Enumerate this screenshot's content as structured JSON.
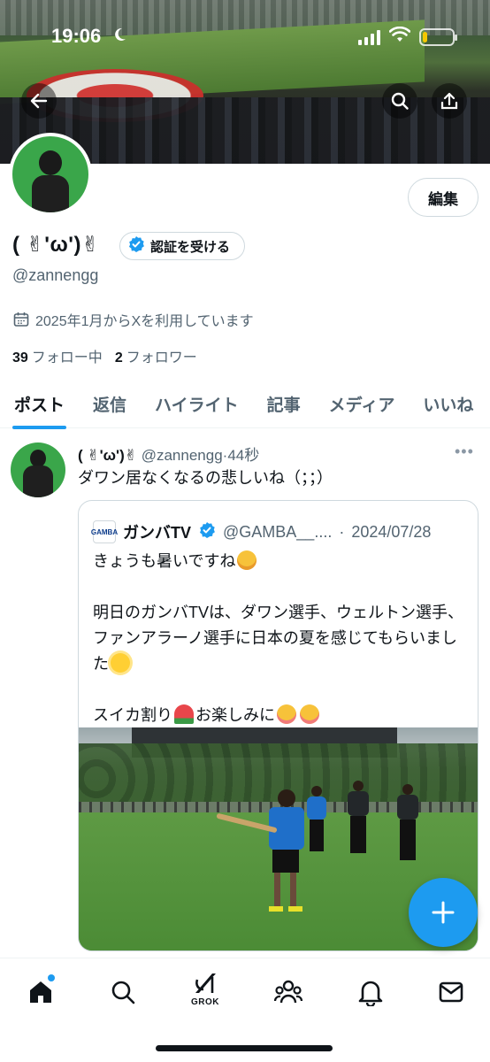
{
  "status_bar": {
    "time": "19:06",
    "battery_level": 0.15
  },
  "profile": {
    "edit_label": "編集",
    "display_name": "( ✌︎'ω')✌︎",
    "verify_label": "認証を受ける",
    "handle": "@zannengg",
    "joined": "2025年1月からXを利用しています",
    "following_count": "39",
    "following_label": "フォロー中",
    "followers_count": "2",
    "followers_label": "フォロワー"
  },
  "tabs": [
    {
      "label": "ポスト",
      "active": true
    },
    {
      "label": "返信"
    },
    {
      "label": "ハイライト"
    },
    {
      "label": "記事"
    },
    {
      "label": "メディア"
    },
    {
      "label": "いいね"
    }
  ],
  "post": {
    "name": "( ✌︎'ω')✌︎",
    "handle": "@zannengg",
    "time": "44秒",
    "text": "ダワン居なくなるの悲しいね（；；）",
    "quote": {
      "logo_text": "GAMBA",
      "name": "ガンバTV",
      "handle": "@GAMBA__....",
      "date": "2024/07/28",
      "line1": "きょうも暑いですね",
      "line2": "明日のガンバTVは、ダワン選手、ウェルトン選手、ファンアラーノ選手に日本の夏を感じてもらいました",
      "line3a": "スイカ割り",
      "line3b": "お楽しみに"
    }
  },
  "bottom_nav": {
    "grok_label": "GROK"
  },
  "colors": {
    "accent": "#1d9bf0",
    "text": "#0f1419",
    "muted": "#536471"
  }
}
